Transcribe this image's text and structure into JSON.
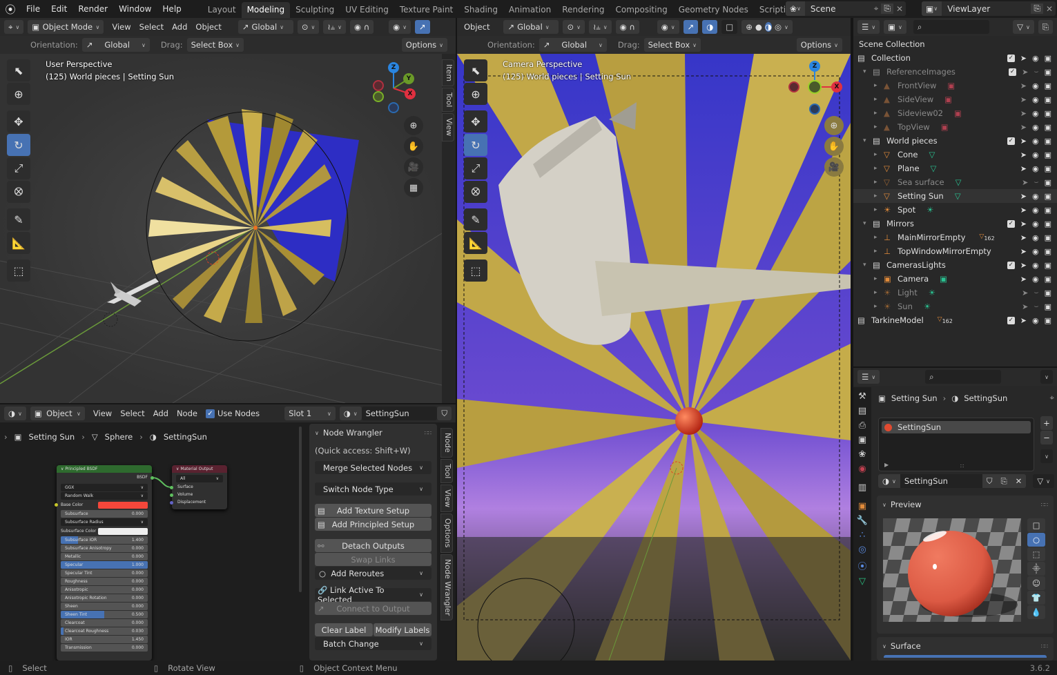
{
  "app": {
    "version": "3.6.2"
  },
  "menu": [
    "File",
    "Edit",
    "Render",
    "Window",
    "Help"
  ],
  "workspaces": [
    {
      "label": "Layout",
      "active": false
    },
    {
      "label": "Modeling",
      "active": true
    },
    {
      "label": "Sculpting",
      "active": false
    },
    {
      "label": "UV Editing",
      "active": false
    },
    {
      "label": "Texture Paint",
      "active": false
    },
    {
      "label": "Shading",
      "active": false
    },
    {
      "label": "Animation",
      "active": false
    },
    {
      "label": "Rendering",
      "active": false
    },
    {
      "label": "Compositing",
      "active": false
    },
    {
      "label": "Geometry Nodes",
      "active": false
    },
    {
      "label": "Scripting",
      "active": false
    }
  ],
  "scene": {
    "name": "Scene",
    "view_layer": "ViewLayer"
  },
  "viewport_left": {
    "mode": "Object Mode",
    "menus": [
      "View",
      "Select",
      "Add",
      "Object"
    ],
    "transform_orientation": "Global",
    "orientation_label": "Orientation:",
    "orientation_value": "Global",
    "drag_label": "Drag:",
    "drag_value": "Select Box",
    "options": "Options",
    "overlay_line1": "User Perspective",
    "overlay_line2": "(125) World pieces | Setting Sun",
    "side_tabs": [
      "Item",
      "Tool",
      "View"
    ]
  },
  "viewport_right": {
    "mode": "Object",
    "transform_orientation": "Global",
    "orientation_label": "Orientation:",
    "orientation_value": "Global",
    "drag_label": "Drag:",
    "drag_value": "Select Box",
    "options": "Options",
    "overlay_line1": "Camera Perspective",
    "overlay_line2": "(125) World pieces | Setting Sun"
  },
  "gizmo": {
    "x": "X",
    "y": "Y",
    "z": "Z"
  },
  "outliner": {
    "title": "Scene Collection",
    "rows": [
      {
        "name": "Collection",
        "indent": 0,
        "type": "collection",
        "checkbox": true,
        "faded": false,
        "visible": true
      },
      {
        "name": "ReferenceImages",
        "indent": 1,
        "type": "collection",
        "checkbox": true,
        "faded": true,
        "visible": false
      },
      {
        "name": "FrontView",
        "indent": 2,
        "type": "image",
        "checkbox": false,
        "faded": true,
        "visible": true
      },
      {
        "name": "SideView",
        "indent": 2,
        "type": "image",
        "checkbox": false,
        "faded": true,
        "visible": true
      },
      {
        "name": "Sideview02",
        "indent": 2,
        "type": "image",
        "checkbox": false,
        "faded": true,
        "visible": true
      },
      {
        "name": "TopView",
        "indent": 2,
        "type": "image",
        "checkbox": false,
        "faded": true,
        "visible": true
      },
      {
        "name": "World pieces",
        "indent": 1,
        "type": "collection",
        "checkbox": true,
        "faded": false,
        "visible": true
      },
      {
        "name": "Cone",
        "indent": 2,
        "type": "mesh",
        "checkbox": false,
        "faded": false,
        "visible": true
      },
      {
        "name": "Plane",
        "indent": 2,
        "type": "mesh",
        "checkbox": false,
        "faded": false,
        "visible": true
      },
      {
        "name": "Sea surface",
        "indent": 2,
        "type": "mesh",
        "checkbox": false,
        "faded": true,
        "visible": false
      },
      {
        "name": "Setting Sun",
        "indent": 2,
        "type": "mesh",
        "checkbox": false,
        "faded": false,
        "visible": true,
        "active": true
      },
      {
        "name": "Spot",
        "indent": 2,
        "type": "light",
        "checkbox": false,
        "faded": false,
        "visible": true
      },
      {
        "name": "Mirrors",
        "indent": 1,
        "type": "collection",
        "checkbox": true,
        "faded": false,
        "visible": true
      },
      {
        "name": "MainMirrorEmpty",
        "indent": 2,
        "type": "empty",
        "checkbox": false,
        "faded": false,
        "visible": true,
        "badge": "162"
      },
      {
        "name": "TopWindowMirrorEmpty",
        "indent": 2,
        "type": "empty",
        "checkbox": false,
        "faded": false,
        "visible": true
      },
      {
        "name": "CamerasLights",
        "indent": 1,
        "type": "collection",
        "checkbox": true,
        "faded": false,
        "visible": true
      },
      {
        "name": "Camera",
        "indent": 2,
        "type": "camera",
        "checkbox": false,
        "faded": false,
        "visible": true
      },
      {
        "name": "Light",
        "indent": 2,
        "type": "light",
        "checkbox": false,
        "faded": true,
        "visible": false
      },
      {
        "name": "Sun",
        "indent": 2,
        "type": "light",
        "checkbox": false,
        "faded": true,
        "visible": false
      },
      {
        "name": "TarkineModel",
        "indent": 0,
        "type": "collection",
        "checkbox": true,
        "faded": false,
        "visible": true,
        "badge": "162"
      }
    ]
  },
  "properties": {
    "breadcrumb_object": "Setting Sun",
    "breadcrumb_material": "SettingSun",
    "slot_item": "SettingSun",
    "material_name": "SettingSun",
    "preview_title": "Preview",
    "surface_title": "Surface"
  },
  "node_editor": {
    "type": "Object",
    "menus": [
      "View",
      "Select",
      "Add",
      "Node"
    ],
    "use_nodes_label": "Use Nodes",
    "use_nodes": true,
    "slot": "Slot 1",
    "material": "SettingSun",
    "breadcrumb": [
      "Setting Sun",
      "Sphere",
      "SettingSun"
    ],
    "bsdf": {
      "title": "Principled BSDF",
      "output": "BSDF",
      "distribution": "GGX",
      "subsurface_method": "Random Walk",
      "base_color_label": "Base Color",
      "base_color": "#f5473b",
      "subsurface_color_label": "Subsurface Color",
      "subsurface_radius_label": "Subsurface Radius",
      "fields": [
        {
          "label": "Subsurface",
          "value": "0.000",
          "fill": 0
        },
        {
          "label": "Subsurface IOR",
          "value": "1.400",
          "fill": 0.2
        },
        {
          "label": "Subsurface Anisotropy",
          "value": "0.000",
          "fill": 0
        },
        {
          "label": "Metallic",
          "value": "0.000",
          "fill": 0
        },
        {
          "label": "Specular",
          "value": "1.000",
          "fill": 1
        },
        {
          "label": "Specular Tint",
          "value": "0.000",
          "fill": 0
        },
        {
          "label": "Roughness",
          "value": "0.000",
          "fill": 0
        },
        {
          "label": "Anisotropic",
          "value": "0.000",
          "fill": 0
        },
        {
          "label": "Anisotropic Rotation",
          "value": "0.000",
          "fill": 0
        },
        {
          "label": "Sheen",
          "value": "0.000",
          "fill": 0
        },
        {
          "label": "Sheen Tint",
          "value": "0.500",
          "fill": 0.5
        },
        {
          "label": "Clearcoat",
          "value": "0.000",
          "fill": 0
        },
        {
          "label": "Clearcoat Roughness",
          "value": "0.030",
          "fill": 0.03
        },
        {
          "label": "IOR",
          "value": "1.450",
          "fill": 0
        },
        {
          "label": "Transmission",
          "value": "0.000",
          "fill": 0
        }
      ]
    },
    "output_node": {
      "title": "Material Output",
      "target": "All",
      "inputs": [
        "Surface",
        "Volume",
        "Displacement"
      ]
    },
    "side_tabs": [
      "Node",
      "Tool",
      "View",
      "Options",
      "Node Wrangler"
    ]
  },
  "node_wrangler": {
    "title": "Node Wrangler",
    "hint": "(Quick access: Shift+W)",
    "merge": "Merge Selected Nodes",
    "switch": "Switch Node Type",
    "add_texture": "Add Texture Setup",
    "add_principled": "Add Principled Setup",
    "detach": "Detach Outputs",
    "swap": "Swap Links",
    "reroutes": "Add Reroutes",
    "link_active": "Link Active To Selected",
    "connect_output": "Connect to Output",
    "clear_label": "Clear Label",
    "modify_labels": "Modify Labels",
    "batch_change": "Batch Change"
  },
  "statusbar": {
    "left": "Select",
    "middle": "Rotate View",
    "right": "Object Context Menu"
  }
}
